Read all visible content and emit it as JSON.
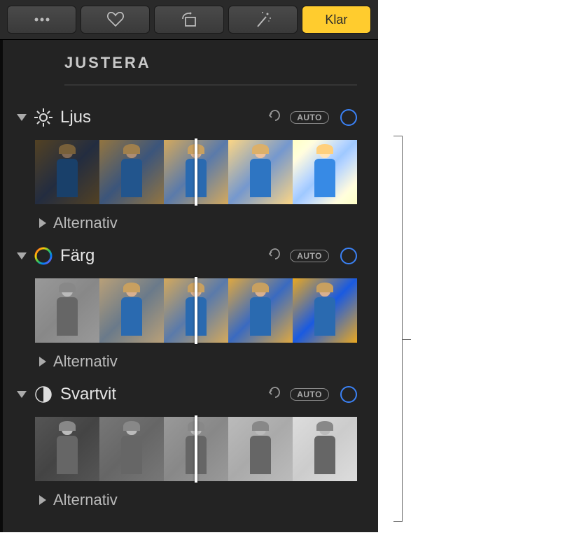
{
  "toolbar": {
    "done_label": "Klar"
  },
  "panel": {
    "title": "JUSTERA"
  },
  "sections": {
    "light": {
      "label": "Ljus",
      "auto_label": "AUTO",
      "options_label": "Alternativ"
    },
    "color": {
      "label": "Färg",
      "auto_label": "AUTO",
      "options_label": "Alternativ"
    },
    "bw": {
      "label": "Svartvit",
      "auto_label": "AUTO",
      "options_label": "Alternativ"
    }
  }
}
